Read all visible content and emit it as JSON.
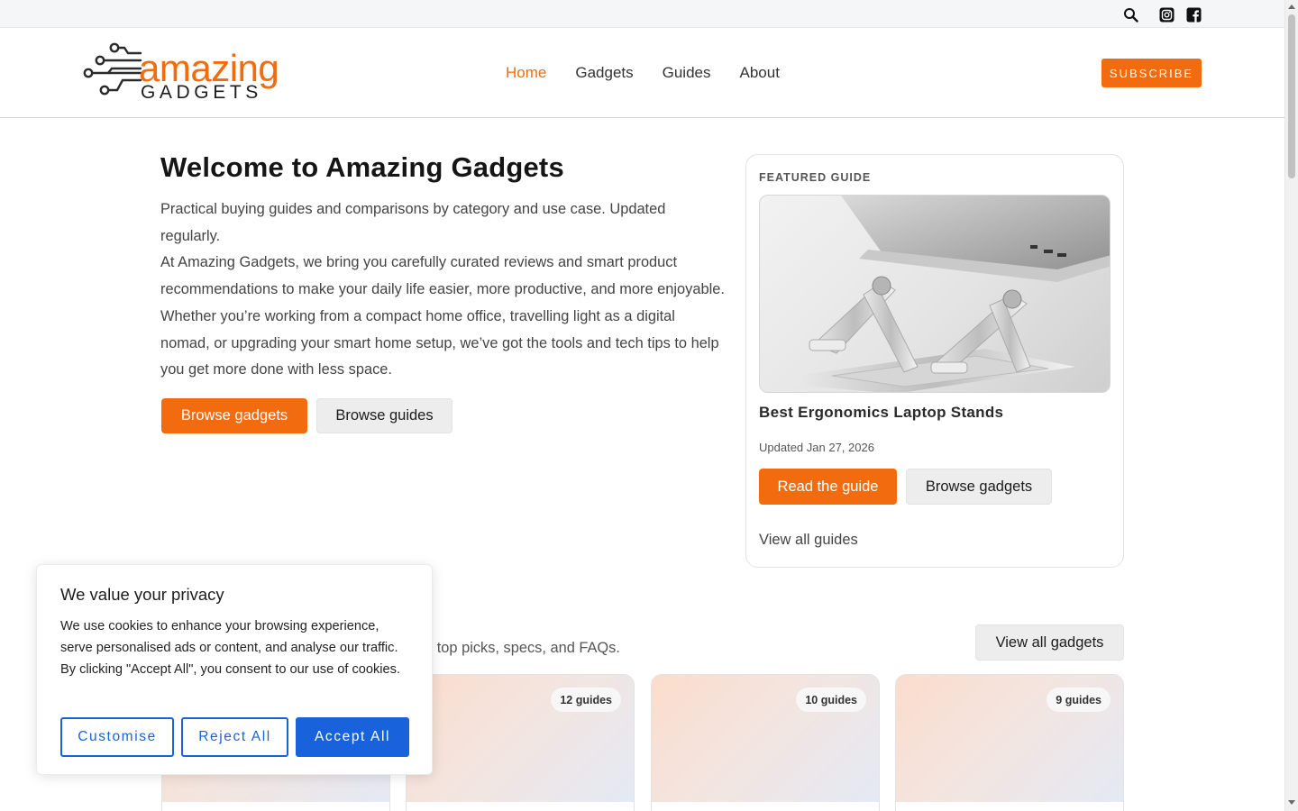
{
  "topbar": {
    "icons": [
      "search-icon",
      "instagram-icon",
      "facebook-icon"
    ]
  },
  "header": {
    "logo": {
      "line1": "amazing",
      "line2": "GADGETS"
    },
    "nav": [
      {
        "label": "Home",
        "active": true
      },
      {
        "label": "Gadgets",
        "active": false
      },
      {
        "label": "Guides",
        "active": false
      },
      {
        "label": "About",
        "active": false
      }
    ],
    "subscribe_label": "SUBSCRIBE"
  },
  "hero": {
    "title": "Welcome to Amazing Gadgets",
    "tagline": "Practical buying guides and comparisons by category and use case. Updated regularly.",
    "intro": "At Amazing Gadgets, we bring you carefully curated reviews and smart product recommendations to make your daily life easier, more productive, and more enjoyable. Whether you’re working from a compact home office, travelling light as a digital nomad, or upgrading your smart home setup, we’ve got the tools and tech tips to help you get more done with less space.",
    "browse_gadgets_label": "Browse gadgets",
    "browse_guides_label": "Browse guides"
  },
  "featured": {
    "label": "FEATURED GUIDE",
    "title": "Best Ergonomics Laptop Stands",
    "updated": "Updated Jan 27, 2026",
    "read_label": "Read the guide",
    "browse_label": "Browse gadgets",
    "view_all_label": "View all guides"
  },
  "categories": {
    "subtitle_visible": "s top picks, specs, and FAQs.",
    "view_all_label": "View all gadgets",
    "cards": [
      {
        "badge": ""
      },
      {
        "badge": "12 guides"
      },
      {
        "badge": "10 guides"
      },
      {
        "badge": "9 guides"
      }
    ]
  },
  "cookie": {
    "title": "We value your privacy",
    "text": "We use cookies to enhance your browsing experience, serve personalised ads or content, and analyse our traffic. By clicking \"Accept All\", you consent to our use of cookies.",
    "customise_label": "Customise",
    "reject_label": "Reject All",
    "accept_label": "Accept All"
  },
  "colors": {
    "accent": "#f26b0f",
    "cookie_blue": "#1863dc"
  }
}
